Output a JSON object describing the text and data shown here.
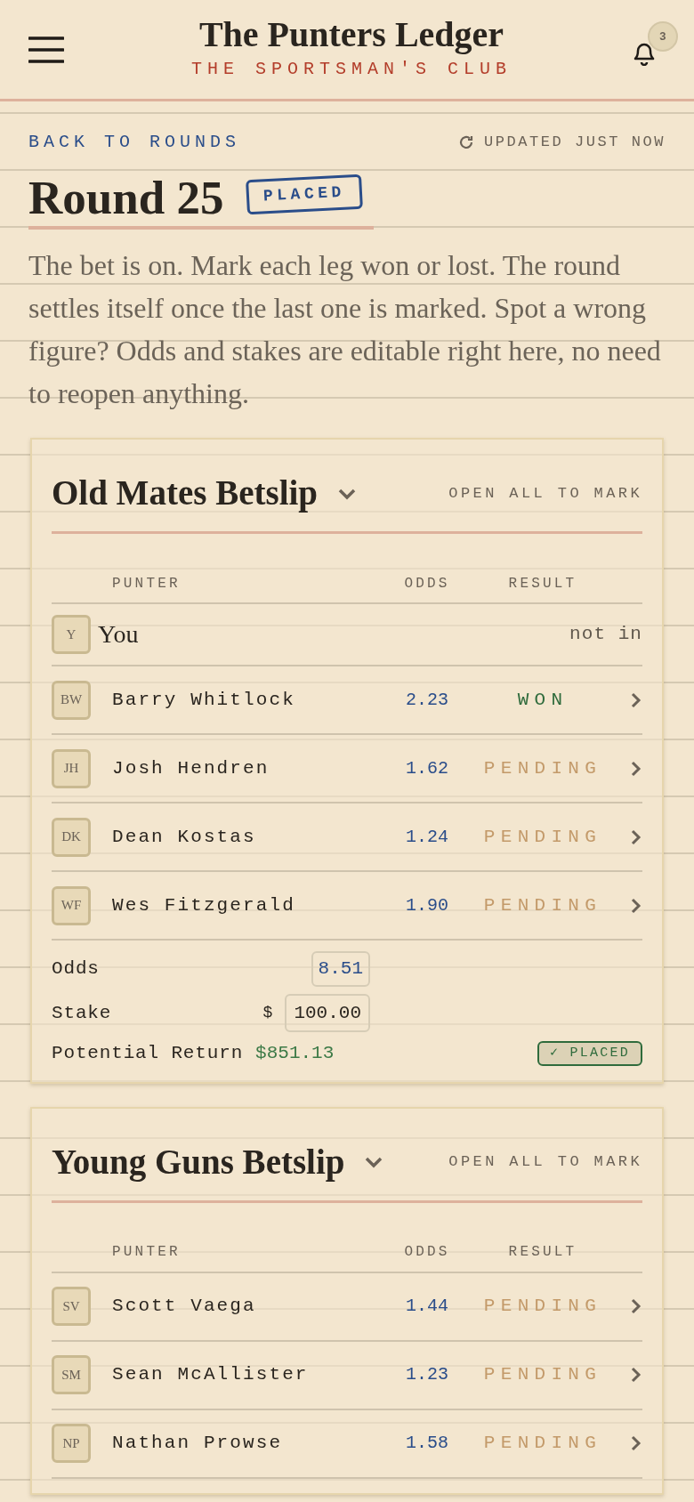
{
  "header": {
    "title": "The Punters Ledger",
    "subtitle": "THE SPORTSMAN'S CLUB",
    "notification_count": "3"
  },
  "nav": {
    "back_link": "BACK TO ROUNDS",
    "updated": "UPDATED JUST NOW"
  },
  "round": {
    "title": "Round 25",
    "status": "PLACED"
  },
  "intro": "The bet is on. Mark each leg won or lost. The round settles itself once the last one is marked. Spot a wrong figure? Odds and stakes are editable right here, no need to reopen anything.",
  "betslips": [
    {
      "name": "Old Mates Betslip",
      "action": "OPEN ALL TO MARK",
      "columns": [
        "PUNTER",
        "ODDS",
        "RESULT"
      ],
      "rows": [
        {
          "kind": "self",
          "initials": "Y",
          "name": "You",
          "result": "not in"
        },
        {
          "kind": "won",
          "initials": "BW",
          "name": "Barry Whitlock",
          "odds": "2.23",
          "result": "WON"
        },
        {
          "kind": "pending",
          "initials": "JH",
          "name": "Josh Hendren",
          "odds": "1.62",
          "result": "PENDING"
        },
        {
          "kind": "pending",
          "initials": "DK",
          "name": "Dean Kostas",
          "odds": "1.24",
          "result": "PENDING"
        },
        {
          "kind": "pending",
          "initials": "WF",
          "name": "Wes Fitzgerald",
          "odds": "1.90",
          "result": "PENDING"
        }
      ],
      "totals": {
        "odds_label": "Odds",
        "odds": "8.51",
        "stake_label": "Stake",
        "currency": "$",
        "stake": "100.00",
        "return_label": "Potential Return",
        "return": "$851.13",
        "badge": "✓ PLACED"
      }
    },
    {
      "name": "Young Guns Betslip",
      "action": "OPEN ALL TO MARK",
      "columns": [
        "PUNTER",
        "ODDS",
        "RESULT"
      ],
      "rows": [
        {
          "kind": "pending",
          "initials": "SV",
          "name": "Scott Vaega",
          "odds": "1.44",
          "result": "PENDING"
        },
        {
          "kind": "pending",
          "initials": "SM",
          "name": "Sean McAllister",
          "odds": "1.23",
          "result": "PENDING"
        },
        {
          "kind": "pending",
          "initials": "NP",
          "name": "Nathan Prowse",
          "odds": "1.58",
          "result": "PENDING"
        }
      ]
    }
  ]
}
